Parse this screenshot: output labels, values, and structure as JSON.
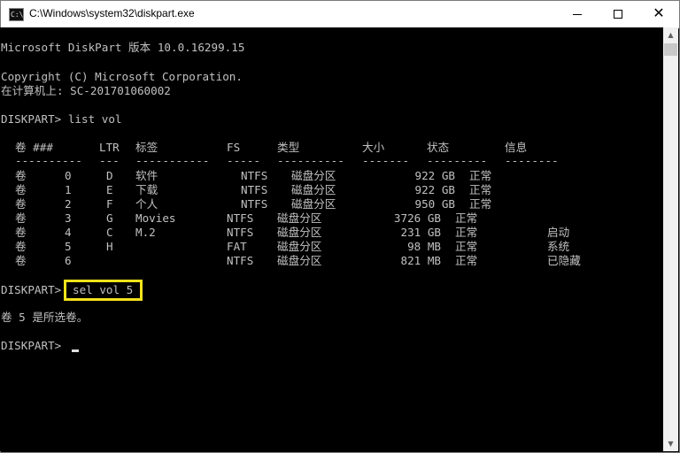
{
  "window": {
    "title": "C:\\Windows\\system32\\diskpart.exe",
    "icon_name": "console-app-icon",
    "controls": {
      "minimize": "minimize-icon",
      "maximize": "maximize-icon",
      "close": "close-icon"
    }
  },
  "console": {
    "version_line": "Microsoft DiskPart 版本 10.0.16299.15",
    "copyright_line": "Copyright (C) Microsoft Corporation.",
    "computer_line": "在计算机上: SC-201701060002",
    "command1": "DISKPART> list vol",
    "table": {
      "headers": [
        "卷 ###",
        "LTR",
        "标签",
        "FS",
        "类型",
        "大小",
        "状态",
        "信息"
      ],
      "separators": [
        "----------",
        "---",
        "-----------",
        "-----",
        "----------",
        "-------",
        "---------",
        "--------"
      ],
      "rows": [
        {
          "vol": "卷",
          "num": "0",
          "ltr": "D",
          "label": "软件",
          "fs": "NTFS",
          "type": "磁盘分区",
          "size": "922 GB",
          "status": "正常",
          "info": ""
        },
        {
          "vol": "卷",
          "num": "1",
          "ltr": "E",
          "label": "下载",
          "fs": "NTFS",
          "type": "磁盘分区",
          "size": "922 GB",
          "status": "正常",
          "info": ""
        },
        {
          "vol": "卷",
          "num": "2",
          "ltr": "F",
          "label": "个人",
          "fs": "NTFS",
          "type": "磁盘分区",
          "size": "950 GB",
          "status": "正常",
          "info": ""
        },
        {
          "vol": "卷",
          "num": "3",
          "ltr": "G",
          "label": "Movies",
          "fs": "NTFS",
          "type": "磁盘分区",
          "size": "3726 GB",
          "status": "正常",
          "info": ""
        },
        {
          "vol": "卷",
          "num": "4",
          "ltr": "C",
          "label": "M.2",
          "fs": "NTFS",
          "type": "磁盘分区",
          "size": "231 GB",
          "status": "正常",
          "info": "启动"
        },
        {
          "vol": "卷",
          "num": "5",
          "ltr": "H",
          "label": "",
          "fs": "FAT",
          "type": "磁盘分区",
          "size": "98 MB",
          "status": "正常",
          "info": "系统"
        },
        {
          "vol": "卷",
          "num": "6",
          "ltr": "",
          "label": "",
          "fs": "NTFS",
          "type": "磁盘分区",
          "size": "821 MB",
          "status": "正常",
          "info": "已隐藏"
        }
      ]
    },
    "prompt2": "DISKPART>",
    "command2": "sel vol 5",
    "result_line": "卷 5 是所选卷。",
    "prompt3": "DISKPART>",
    "highlight_color": "#f4e21b"
  }
}
